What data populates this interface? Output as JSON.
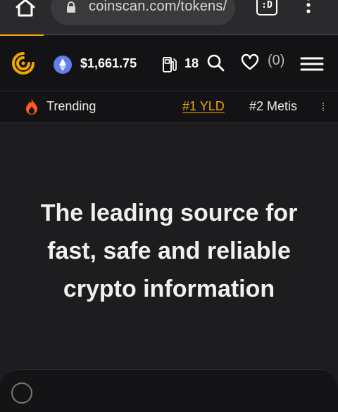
{
  "browser": {
    "url": "coinscan.com/tokens/",
    "tab_switcher_label": ":D"
  },
  "header": {
    "eth_price": "$1,661.75",
    "gas": "18",
    "watchlist_count": "(0)"
  },
  "trending": {
    "label": "Trending",
    "items": [
      "#1 YLD",
      "#2 Metis"
    ]
  },
  "hero": {
    "headline": "The leading source for fast, safe and reliable crypto information"
  },
  "colors": {
    "accent": "#f0a500",
    "eth": "#627eea",
    "fire": "#ff5a1f",
    "background": "#1d1d1f"
  },
  "icons": [
    "home-icon",
    "lock-icon",
    "kebab-menu-icon",
    "logo-icon",
    "eth-icon",
    "gas-pump-icon",
    "search-icon",
    "heart-icon",
    "hamburger-menu-icon",
    "fire-icon"
  ]
}
